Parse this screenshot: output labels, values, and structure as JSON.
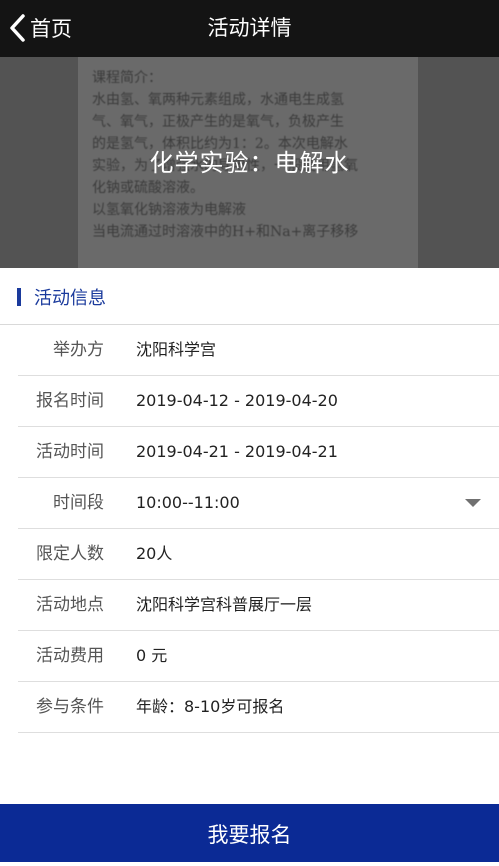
{
  "nav": {
    "back_label": "首页",
    "title": "活动详情"
  },
  "banner": {
    "title": "化学实验：电解水",
    "background_text": [
      "课程简介：",
      "水由氢、氧两种元素组成，水通电生成氢",
      "气、氧气，正极产生的是氧气，负极产生",
      "的是氢气，体积比约为1：2。本次电解水",
      "实验，为了增强水的导电性，一般使用氢氧",
      "化钠或硫酸溶液。",
      "以氢氧化钠溶液为电解液",
      "当电流通过时溶液中的H+和Na+离子移移"
    ]
  },
  "section": {
    "title": "活动信息"
  },
  "details": [
    {
      "label": "举办方",
      "value": "沈阳科学宫"
    },
    {
      "label": "报名时间",
      "value": "2019-04-12 - 2019-04-20"
    },
    {
      "label": "活动时间",
      "value": "2019-04-21 - 2019-04-21"
    },
    {
      "label": "时间段",
      "value": "10:00--11:00"
    },
    {
      "label": "限定人数",
      "value": "20人"
    },
    {
      "label": "活动地点",
      "value": "沈阳科学宫科普展厅一层"
    },
    {
      "label": "活动费用",
      "value": "0 元"
    },
    {
      "label": "参与条件",
      "value": "年龄：8-10岁可报名"
    }
  ],
  "footer": {
    "button_label": "我要报名"
  },
  "colors": {
    "accent": "#1a3a9c",
    "button": "#0b2a95",
    "navbar": "#141414"
  },
  "icons": {
    "back": "chevron-left-icon",
    "dropdown": "caret-down-icon"
  }
}
